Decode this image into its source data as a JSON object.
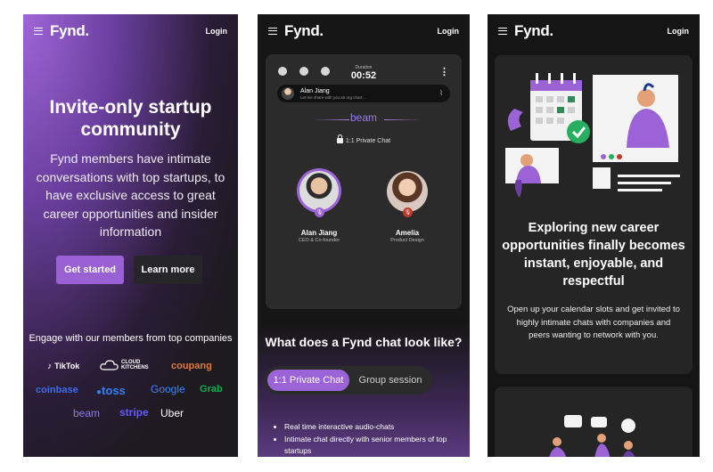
{
  "screens": [
    {
      "nav": {
        "logo": "Fynd.",
        "login": "Login"
      },
      "hero": {
        "title": "Invite-only startup community",
        "description": "Fynd members have intimate conversations with top startups, to have exclusive access to great career opportunities and insider information"
      },
      "buttons": {
        "primary": "Get started",
        "secondary": "Learn more"
      },
      "engage": "Engage with our members from top companies",
      "companies": [
        "TikTok",
        "CLOUD KITCHENS",
        "coupang",
        "coinbase",
        "toss",
        "Google",
        "Grab",
        "beam",
        "stripe",
        "Uber"
      ],
      "company_colors": {
        "TikTok": "#ffffff",
        "CLOUD KITCHENS": "#ffffff",
        "coupang": "#e07b3a",
        "coinbase": "#3a6df0",
        "toss": "#3182f6",
        "Google": "#4285f4",
        "Grab": "#00b14f",
        "beam": "#8b7bf0",
        "stripe": "#635bff",
        "Uber": "#ffffff"
      }
    },
    {
      "nav": {
        "logo": "Fynd.",
        "login": "Login"
      },
      "chat_card": {
        "duration_label": "Duration",
        "duration": "00:52",
        "message_name": "Alan Jiang",
        "message_text": "Let me share with you an org chart...",
        "brand": "beam",
        "chat_type": "1:1 Private Chat",
        "participants": [
          {
            "name": "Alan Jiang",
            "role": "CEO & Co-founder"
          },
          {
            "name": "Amelia",
            "role": "Product Design"
          }
        ]
      },
      "question": "What does a Fynd chat look like?",
      "tabs": [
        "1:1 Private Chat",
        "Group session"
      ],
      "bullets": [
        "Real time interactive audio-chats",
        "Intimate chat directly with senior members of top startups"
      ]
    },
    {
      "nav": {
        "logo": "Fynd.",
        "login": "Login"
      },
      "title": "Exploring new career opportunities finally becomes instant, enjoyable, and respectful",
      "description": "Open up your calendar slots and get invited to highly intimate chats with companies and peers wanting to network with you."
    }
  ],
  "colors": {
    "accent": "#9b63d6",
    "background": "#151515"
  }
}
